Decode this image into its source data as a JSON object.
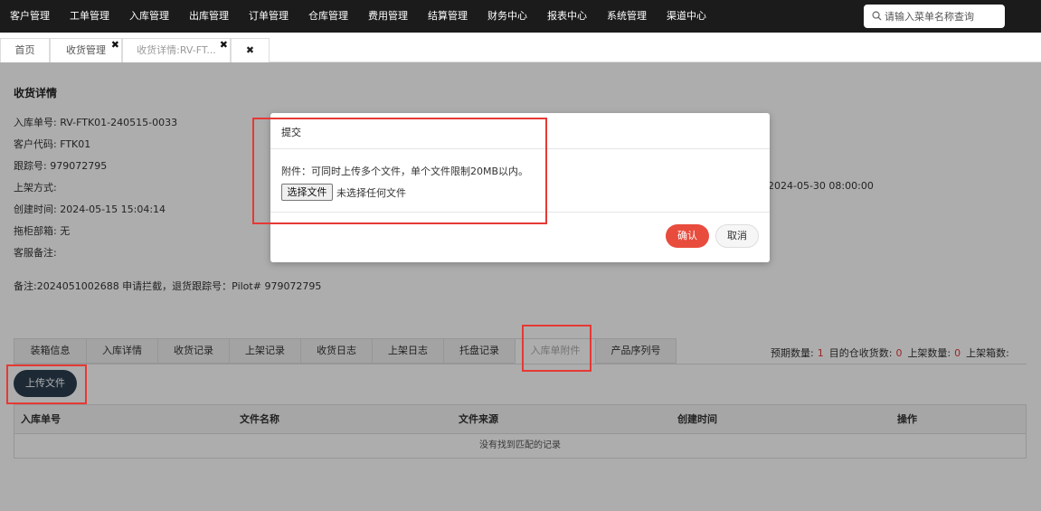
{
  "nav": {
    "items": [
      "客户管理",
      "工单管理",
      "入库管理",
      "出库管理",
      "订单管理",
      "仓库管理",
      "费用管理",
      "结算管理",
      "财务中心",
      "报表中心",
      "系统管理",
      "渠道中心"
    ],
    "search_placeholder": "请输入菜单名称查询"
  },
  "tabs": {
    "home": "首页",
    "receiving": "收货管理",
    "detail": "收货详情:RV-FT...",
    "close": "✖"
  },
  "detail": {
    "title": "收货详情",
    "order_no": "入库单号: RV-FTK01-240515-0033",
    "customer_code": "客户代码: FTK01",
    "tracking_no": "跟踪号: 979072795",
    "putaway_method": "上架方式:",
    "created_time": "创建时间: 2024-05-15 15:04:14",
    "container": "拖柜部箱: 无",
    "cs_remark": "客服备注:",
    "datetime_right": "2024-05-30 08:00:00",
    "remark": "备注:2024051002688 申请拦截，退货跟踪号：Pilot# 979072795"
  },
  "sub_tabs": [
    "装箱信息",
    "入库详情",
    "收货记录",
    "上架记录",
    "收货日志",
    "上架日志",
    "托盘记录",
    "入库单附件",
    "产品序列号"
  ],
  "counts": {
    "expected_label": "预期数量:",
    "expected_value": "1",
    "received_label": "目的仓收货数:",
    "received_value": "0",
    "putaway_label": "上架数量:",
    "putaway_value": "0",
    "putaway_boxes_label": "上架箱数:"
  },
  "upload_button": "上传文件",
  "table": {
    "columns": [
      "入库单号",
      "文件名称",
      "文件来源",
      "创建时间",
      "操作"
    ],
    "empty": "没有找到匹配的记录"
  },
  "modal": {
    "title": "提交",
    "note": "附件：可同时上传多个文件，单个文件限制20MB以内。",
    "file_button": "选择文件",
    "file_status": "未选择任何文件",
    "confirm": "确认",
    "cancel": "取消"
  },
  "colors": {
    "nav_bg": "#1b1b1b",
    "confirm": "#e84c3d",
    "upload": "#2b3e50",
    "highlight": "#e53935",
    "count_number": "#e4393c"
  }
}
